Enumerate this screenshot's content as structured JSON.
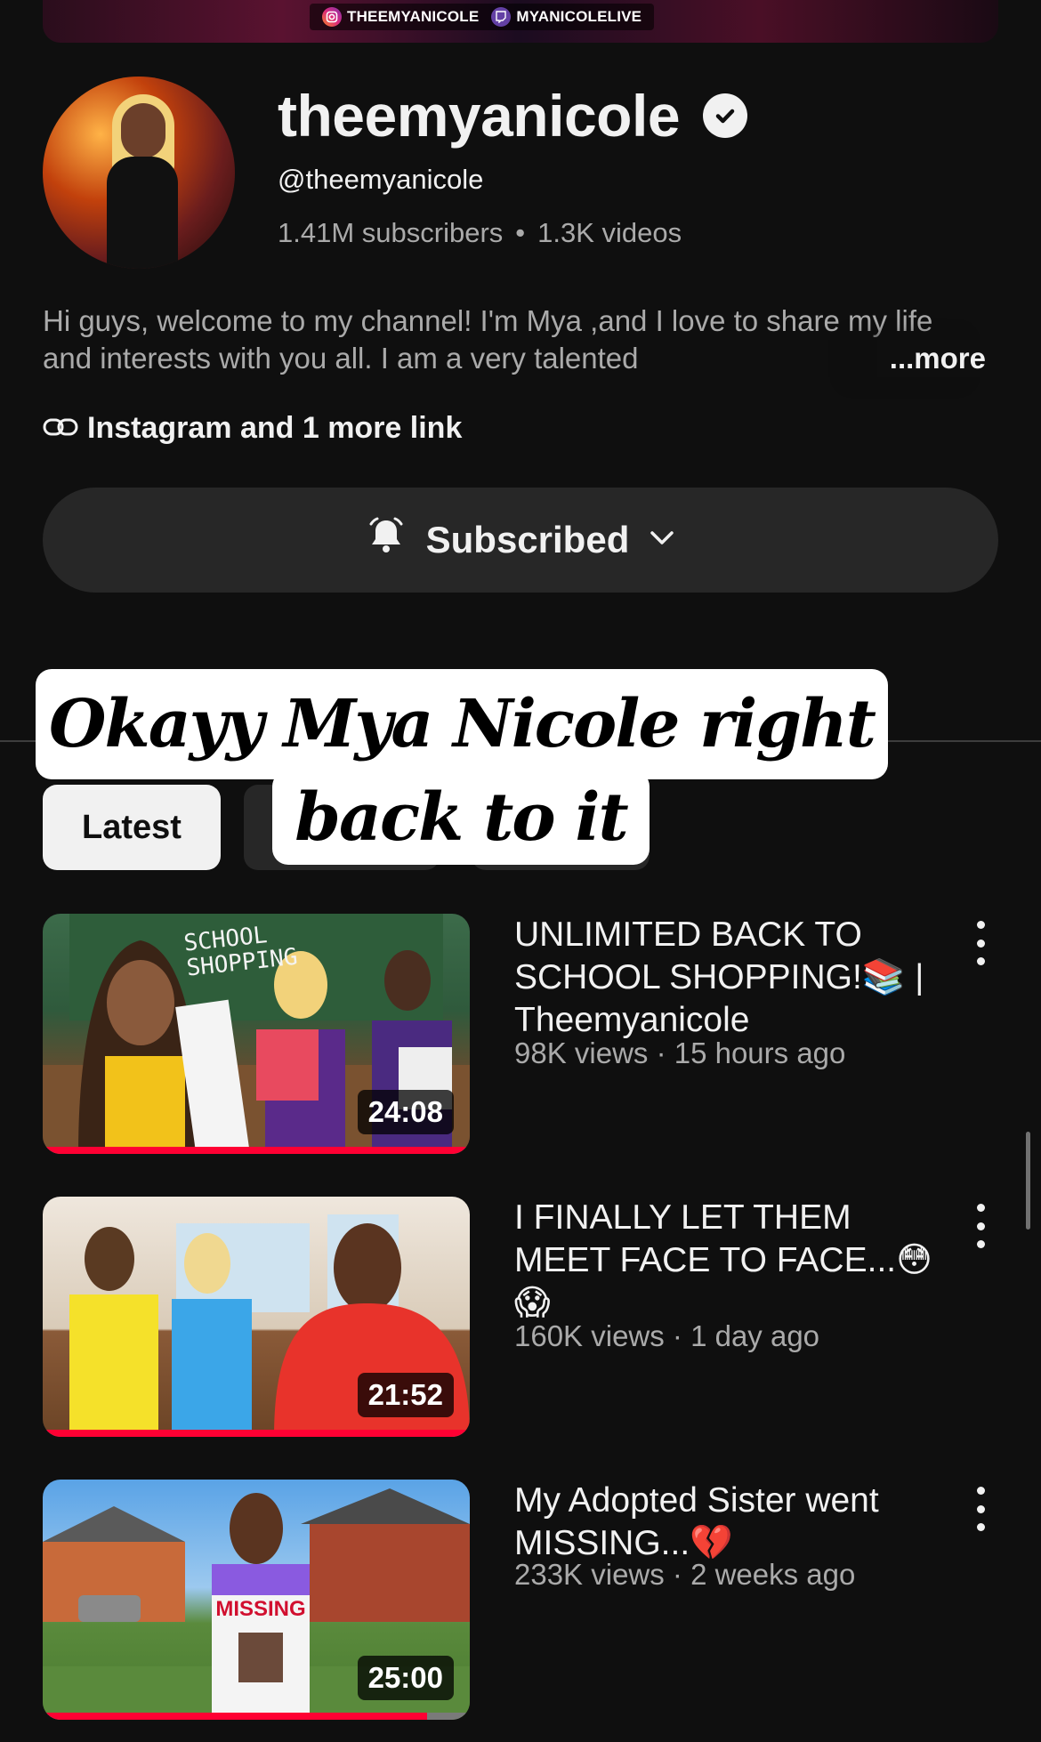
{
  "banner": {
    "instagram": "THEEMYANICOLE",
    "twitch": "MYANICOLELIVE"
  },
  "channel": {
    "name": "theemyanicole",
    "handle": "@theemyanicole",
    "subscribers": "1.41M subscribers",
    "separator": "•",
    "videos": "1.3K videos",
    "description": "Hi guys, welcome to my channel! I'm Mya ,and I love to share my life and interests with you all. I am a very talented",
    "more": "...more",
    "links": "Instagram and 1 more link"
  },
  "subscribe": {
    "label": "Subscribed"
  },
  "overlay": {
    "line1": "Okayy Mya Nicole right",
    "line2": "back to it"
  },
  "filters": {
    "active": "Latest"
  },
  "videos": [
    {
      "title": "UNLIMITED BACK TO SCHOOL SHOPPING!📚 | Theemyanicole",
      "meta": "98K views · 15 hours ago",
      "duration": "24:08",
      "progress": 1.0,
      "thumb_text": "SCHOOL SHOPPING"
    },
    {
      "title": "I FINALLY LET THEM MEET FACE TO FACE...😳😱",
      "meta": "160K views · 1 day ago",
      "duration": "21:52",
      "progress": 1.0
    },
    {
      "title": "My Adopted Sister went MISSING...💔",
      "meta": "233K views · 2 weeks ago",
      "duration": "25:00",
      "progress": 0.9,
      "thumb_text": "MISSING"
    }
  ],
  "colors": {
    "background": "#0f0f0f",
    "progress": "#ff0033",
    "secondary_text": "#aaaaaa"
  }
}
